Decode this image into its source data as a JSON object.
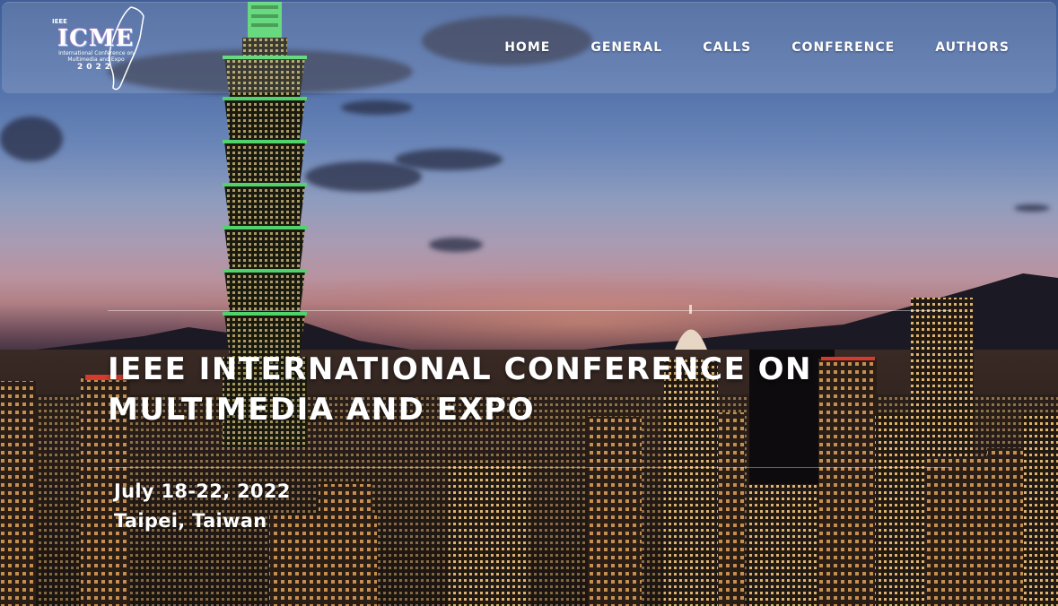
{
  "logo": {
    "ieee": "IEEE",
    "acronym": "ICME",
    "subtitle": "International Conference on Multimedia and Expo",
    "year": "2022"
  },
  "nav": {
    "items": [
      {
        "label": "HOME"
      },
      {
        "label": "GENERAL"
      },
      {
        "label": "CALLS"
      },
      {
        "label": "CONFERENCE"
      },
      {
        "label": "AUTHORS"
      }
    ]
  },
  "hero": {
    "title": "IEEE INTERNATIONAL CONFERENCE ON MULTIMEDIA AND EXPO",
    "date": "July 18-22, 2022",
    "location": "Taipei, Taiwan"
  },
  "colors": {
    "text": "#ffffff",
    "tower_green": "#4fd36a",
    "nav_bg": "rgba(255,255,255,0.14)"
  }
}
